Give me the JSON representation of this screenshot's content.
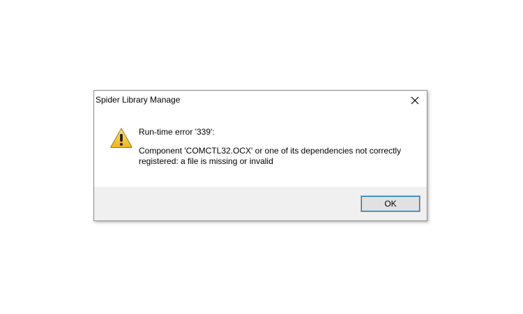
{
  "dialog": {
    "title": "Spider Library Manage",
    "close_icon": "close-icon",
    "warning_icon": "warning-icon",
    "message_heading": "Run-time error '339':",
    "message_detail": "Component 'COMCTL32.OCX' or one of its dependencies not correctly registered: a file is missing or invalid",
    "ok_label": "OK"
  },
  "colors": {
    "footer_background": "#f0f0f0",
    "warning_fill": "#f5c22a",
    "focus_ring": "#0078d7"
  }
}
